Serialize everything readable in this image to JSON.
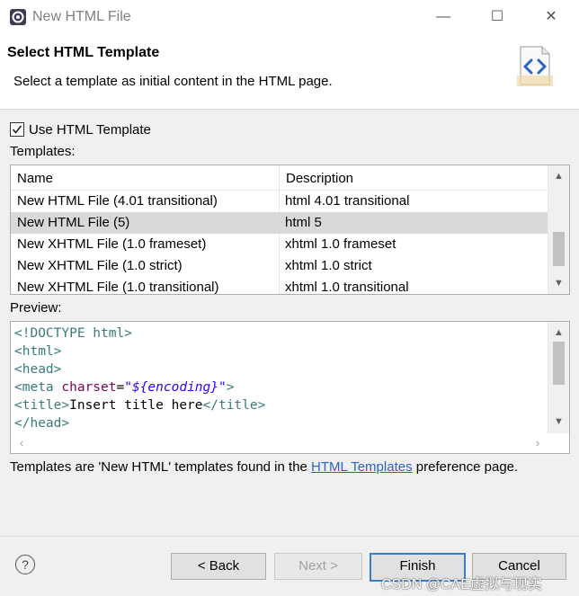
{
  "window": {
    "title": "New HTML File",
    "controls": {
      "minimize": "—",
      "maximize": "☐",
      "close": "✕"
    }
  },
  "header": {
    "title": "Select HTML Template",
    "description": "Select a template as initial content in the HTML page."
  },
  "use_template": {
    "label": "Use HTML Template",
    "checked": true
  },
  "templates": {
    "label": "Templates:",
    "columns": {
      "name": "Name",
      "description": "Description"
    },
    "rows": [
      {
        "name": "New HTML File (4.01 transitional)",
        "description": "html 4.01 transitional",
        "selected": false
      },
      {
        "name": "New HTML File (5)",
        "description": "html 5",
        "selected": true
      },
      {
        "name": "New XHTML File (1.0 frameset)",
        "description": "xhtml 1.0 frameset",
        "selected": false
      },
      {
        "name": "New XHTML File (1.0 strict)",
        "description": "xhtml 1.0 strict",
        "selected": false
      },
      {
        "name": "New XHTML File (1.0 transitional)",
        "description": "xhtml 1.0 transitional",
        "selected": false
      }
    ]
  },
  "preview": {
    "label": "Preview:",
    "lines": {
      "l1_tag": "<!DOCTYPE html>",
      "l2_tag": "<html>",
      "l3_tag": "<head>",
      "l4_tag_open": "<meta ",
      "l4_attr": "charset",
      "l4_eq": "=",
      "l4_value": "\"${encoding}\"",
      "l4_tag_close": ">",
      "l5_tag_open": "<title>",
      "l5_text": "Insert title here",
      "l5_tag_close": "</title>",
      "l6_tag": "</head>"
    }
  },
  "info": {
    "before": "Templates are 'New HTML' templates found in the ",
    "link": "HTML Templates",
    "after": " preference page."
  },
  "buttons": {
    "help": "?",
    "back": "< Back",
    "next": "Next >",
    "finish": "Finish",
    "cancel": "Cancel"
  },
  "watermark": "CSDN @CAE虚拟与现实",
  "colors": {
    "selection": "#d9d9d9",
    "link": "#2a64c5",
    "code_tag": "#3a7b7d",
    "code_attr": "#7f0055",
    "code_string": "#2a00ff",
    "default_button_border": "#3b7bc9"
  }
}
